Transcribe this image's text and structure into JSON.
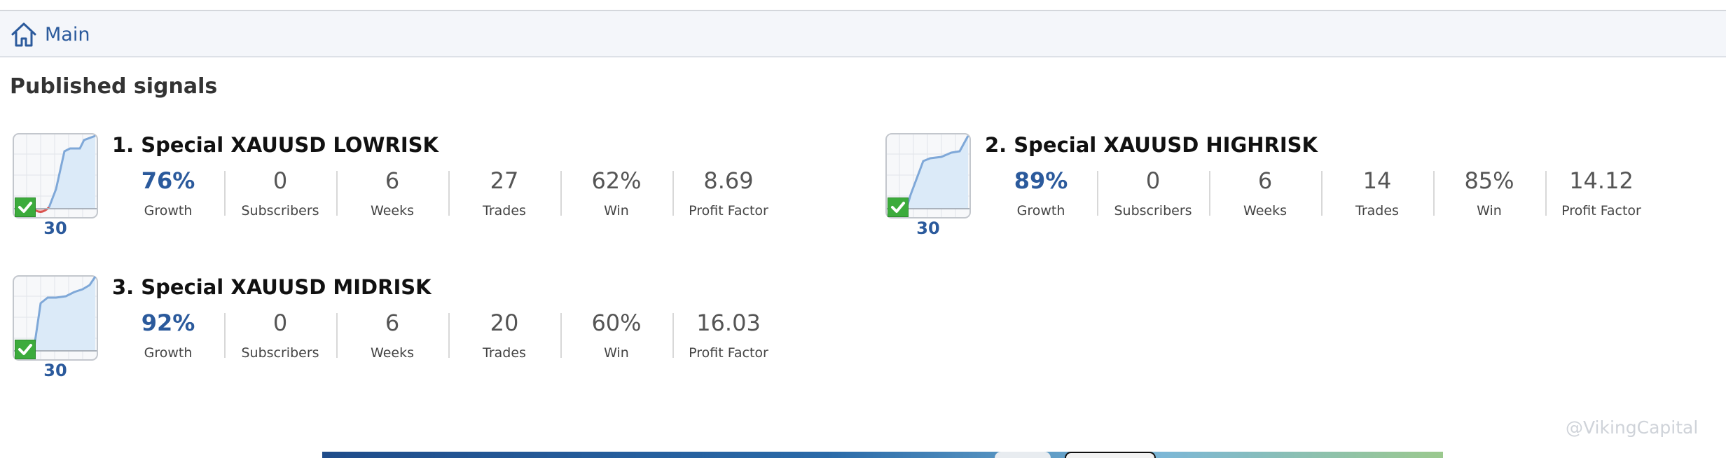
{
  "nav": {
    "home_label": "Main"
  },
  "section_title": "Published signals",
  "signals": [
    {
      "title": "1. Special XAUUSD LOWRISK",
      "thumb_count": "30",
      "stats": [
        {
          "value": "76%",
          "label": "Growth"
        },
        {
          "value": "0",
          "label": "Subscribers"
        },
        {
          "value": "6",
          "label": "Weeks"
        },
        {
          "value": "27",
          "label": "Trades"
        },
        {
          "value": "62%",
          "label": "Win"
        },
        {
          "value": "8.69",
          "label": "Profit Factor"
        }
      ]
    },
    {
      "title": "2. Special XAUUSD HIGHRISK",
      "thumb_count": "30",
      "stats": [
        {
          "value": "89%",
          "label": "Growth"
        },
        {
          "value": "0",
          "label": "Subscribers"
        },
        {
          "value": "6",
          "label": "Weeks"
        },
        {
          "value": "14",
          "label": "Trades"
        },
        {
          "value": "85%",
          "label": "Win"
        },
        {
          "value": "14.12",
          "label": "Profit Factor"
        }
      ]
    },
    {
      "title": "3. Special XAUUSD MIDRISK",
      "thumb_count": "30",
      "stats": [
        {
          "value": "92%",
          "label": "Growth"
        },
        {
          "value": "0",
          "label": "Subscribers"
        },
        {
          "value": "6",
          "label": "Weeks"
        },
        {
          "value": "20",
          "label": "Trades"
        },
        {
          "value": "60%",
          "label": "Win"
        },
        {
          "value": "16.03",
          "label": "Profit Factor"
        }
      ]
    }
  ],
  "watermark": "@VikingCapital",
  "colors": {
    "accent": "#2b5a9c",
    "check": "#3cab3c",
    "chart_line": "#7fa8d8",
    "chart_fill": "#dbeaf8"
  },
  "icons": {
    "home": "home-icon",
    "check": "check-icon"
  }
}
